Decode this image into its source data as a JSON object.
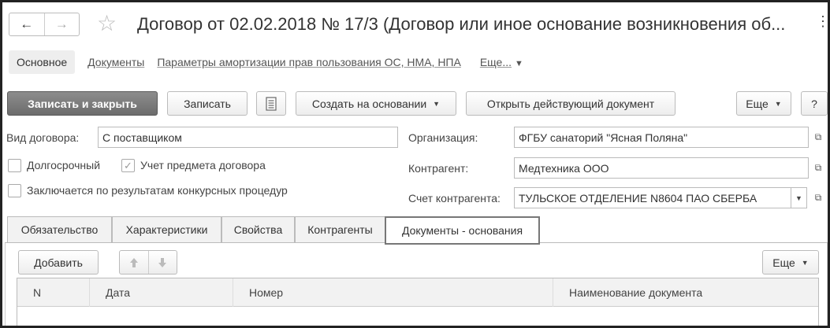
{
  "window": {
    "title": "Договор от 02.02.2018 № 17/3 (Договор или иное основание возникновения об...",
    "back_glyph": "←",
    "forward_glyph": "→",
    "star_glyph": "☆",
    "more_glyph": "⋮"
  },
  "section_nav": {
    "active": "Основное",
    "links": [
      "Документы",
      "Параметры амортизации прав пользования ОС, НМА, НПА"
    ],
    "more": "Еще..."
  },
  "toolbar": {
    "save_close": "Записать и закрыть",
    "save": "Записать",
    "create_based": "Создать на основании",
    "open_current": "Открыть действующий документ",
    "more": "Еще",
    "help": "?"
  },
  "form": {
    "contract_type_label": "Вид договора:",
    "contract_type_value": "С поставщиком",
    "long_term_label": "Долгосрочный",
    "long_term_checked": false,
    "subject_account_label": "Учет предмета договора",
    "subject_account_checked": true,
    "competitive_label": "Заключается по результатам конкурсных процедур",
    "competitive_checked": false,
    "organization_label": "Организация:",
    "organization_value": "ФГБУ санаторий \"Ясная Поляна\"",
    "counterparty_label": "Контрагент:",
    "counterparty_value": "Медтехника ООО",
    "counterparty_account_label": "Счет контрагента:",
    "counterparty_account_value": "ТУЛЬСКОЕ ОТДЕЛЕНИЕ N8604 ПАО СБЕРБА"
  },
  "tabs": [
    "Обязательство",
    "Характеристики",
    "Свойства",
    "Контрагенты",
    "Документы - основания"
  ],
  "active_tab": "Документы - основания",
  "panel": {
    "add": "Добавить",
    "more": "Еще"
  },
  "grid": {
    "columns": [
      "N",
      "Дата",
      "Номер",
      "Наименование документа"
    ],
    "rows": []
  },
  "colors": {
    "primary_button": "#7a7a7a",
    "tab_active_border": "#777777"
  }
}
